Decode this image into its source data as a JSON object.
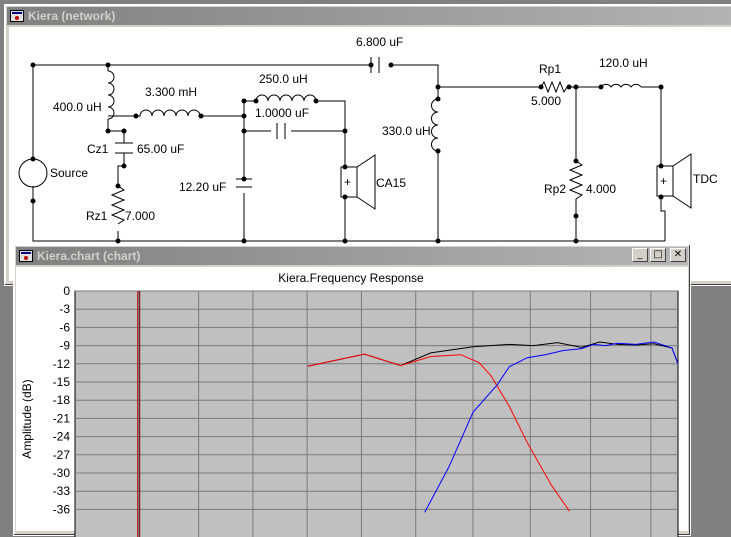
{
  "network_window": {
    "title": "Kiera (network)",
    "components": {
      "c_top": "6.800 uF",
      "l_400": "400.0 uH",
      "l_3300": "3.300 mH",
      "cz1_name": "Cz1",
      "cz1_value": "65.00 uF",
      "source": "Source",
      "rz1_name": "Rz1",
      "rz1_value": "7.000",
      "l_250": "250.0 uH",
      "c_1": "1.0000 uF",
      "c_12": "12.20 uF",
      "ca15": "CA15",
      "l_330": "330.0 uH",
      "rp1_name": "Rp1",
      "rp1_value": "5.000",
      "l_120": "120.0 uH",
      "rp2_name": "Rp2",
      "rp2_value": "4.000",
      "tdc": "TDC"
    }
  },
  "chart_window": {
    "title": "Kiera.chart (chart)",
    "controls": {
      "minimize": "_",
      "maximize": "□",
      "close": "✕"
    }
  },
  "colors": {
    "title_bar": "#808080",
    "plot_bg": "#c0c0c0",
    "grid": "#7a7a7a",
    "series_sum": "#000000",
    "series_woofer": "#ff0000",
    "series_tweeter": "#0000ff",
    "marker": "#c00000"
  },
  "chart_data": {
    "type": "line",
    "title": "Kiera.Frequency Response",
    "ylabel": "Amplitude (dB)",
    "xlabel": "",
    "ylim": [
      -36,
      0
    ],
    "yticks": [
      "0",
      "-3",
      "-6",
      "-9",
      "-12",
      "-15",
      "-18",
      "-21",
      "-24",
      "-27",
      "-30",
      "-33",
      "-36"
    ],
    "xlim": [
      0,
      1
    ],
    "grid": true,
    "series": [
      {
        "color": "#000000",
        "x": [
          0.386,
          0.48,
          0.54,
          0.59,
          0.66,
          0.72,
          0.76,
          0.8,
          0.84,
          0.87,
          0.9,
          0.93,
          0.96,
          0.99,
          1.0
        ],
        "y": [
          -12.4,
          -10.4,
          -12.3,
          -10.2,
          -9.2,
          -8.8,
          -9.0,
          -8.5,
          -9.3,
          -8.4,
          -8.8,
          -8.9,
          -8.7,
          -9.4,
          -12.0
        ]
      },
      {
        "color": "#ff0000",
        "x": [
          0.386,
          0.48,
          0.54,
          0.59,
          0.64,
          0.67,
          0.69,
          0.72,
          0.75,
          0.79,
          0.82
        ],
        "y": [
          -12.4,
          -10.4,
          -12.3,
          -10.8,
          -10.5,
          -11.8,
          -14.0,
          -19.0,
          -25.0,
          -32.0,
          -36.3
        ]
      },
      {
        "color": "#0000ff",
        "x": [
          0.58,
          0.62,
          0.66,
          0.7,
          0.72,
          0.75,
          0.78,
          0.81,
          0.84,
          0.86,
          0.88,
          0.9,
          0.93,
          0.96,
          0.99,
          1.0
        ],
        "y": [
          -36.5,
          -29.0,
          -20.0,
          -15.5,
          -12.5,
          -11.0,
          -10.5,
          -9.8,
          -9.5,
          -8.8,
          -9.0,
          -8.6,
          -8.8,
          -8.4,
          -9.4,
          -12.0
        ]
      }
    ],
    "markers": [
      {
        "x": 0.104,
        "color": "#c00000"
      }
    ]
  }
}
